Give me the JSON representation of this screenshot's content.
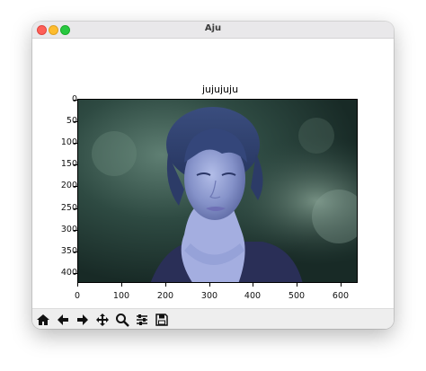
{
  "window": {
    "title": "Aju"
  },
  "plot": {
    "title": "jujujuju",
    "x_ticks": [
      "0",
      "100",
      "200",
      "300",
      "400",
      "500",
      "600"
    ],
    "y_ticks": [
      "0",
      "50",
      "100",
      "150",
      "200",
      "250",
      "300",
      "350",
      "400"
    ]
  },
  "toolbar": {
    "buttons": [
      "home-icon",
      "back-arrow-icon",
      "forward-arrow-icon",
      "pan-icon",
      "zoom-icon",
      "configure-subplots-icon",
      "save-icon"
    ]
  },
  "colors": {
    "titlebar": "#e9e8ea",
    "close": "#fe5f57",
    "minimize": "#febc2e",
    "maximize": "#28c840",
    "toolbar": "#eeeeee"
  }
}
